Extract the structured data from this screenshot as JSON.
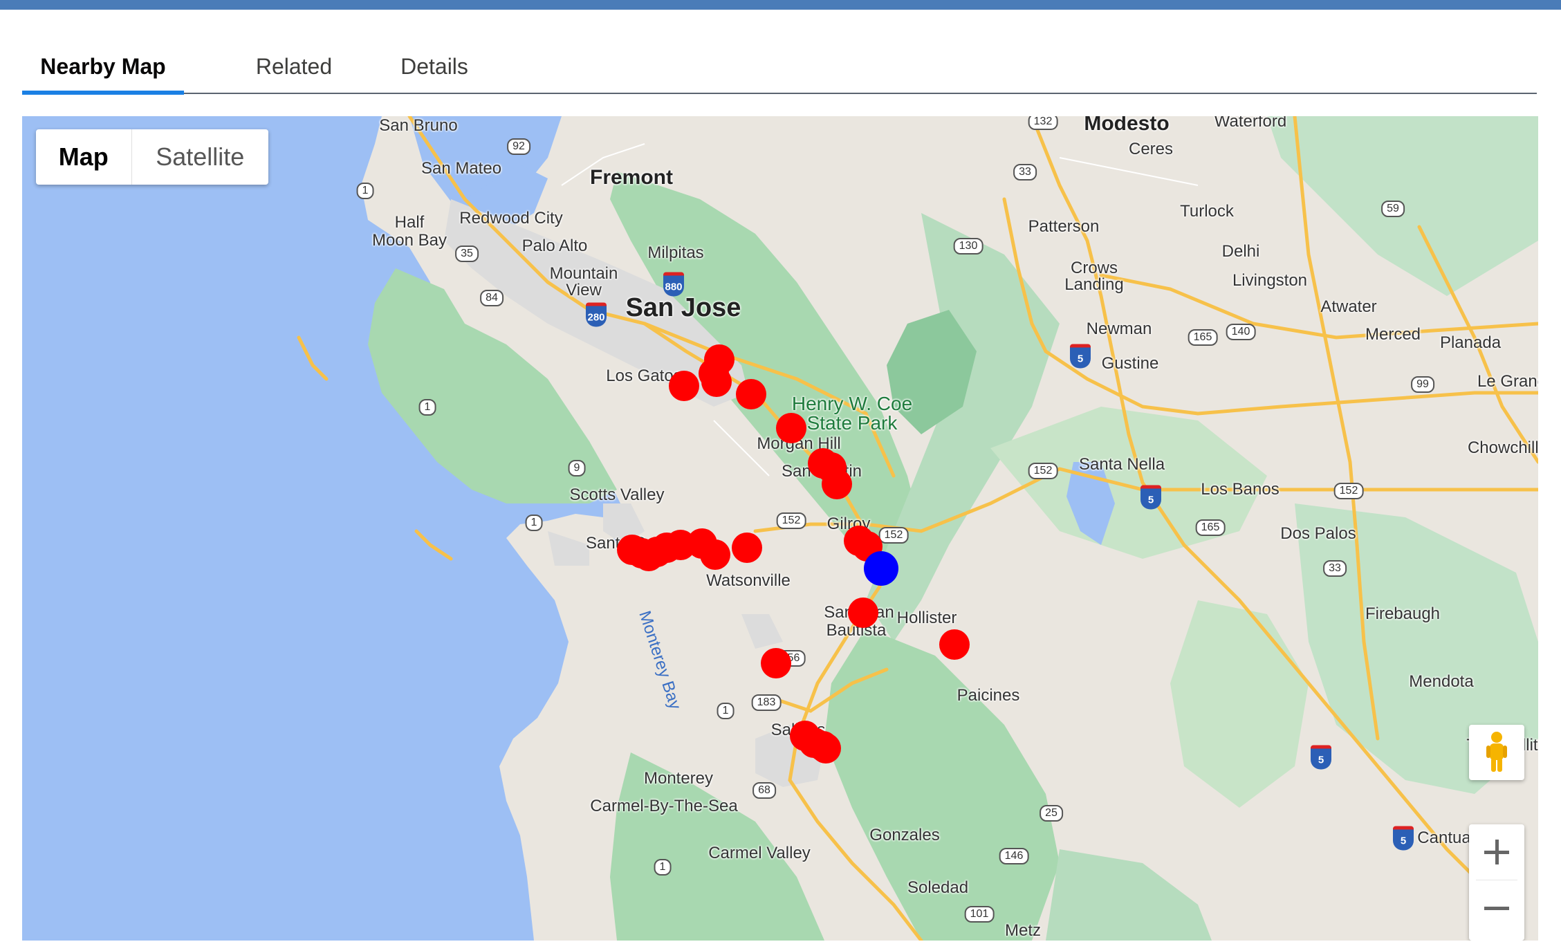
{
  "tabs": [
    {
      "label": "Nearby Map",
      "active": true
    },
    {
      "label": "Related",
      "active": false
    },
    {
      "label": "Details",
      "active": false
    }
  ],
  "map": {
    "map_type_buttons": [
      "Map",
      "Satellite"
    ],
    "selected_map_type": "Map",
    "zoom_in_icon": "plus-icon",
    "zoom_out_icon": "minus-icon",
    "street_view_icon": "pegman-icon",
    "current_location_color": "#0000ff",
    "nearby_marker_color": "#ff0000",
    "nearby_marker_count": 27,
    "current_location_count": 1,
    "labels": {
      "san_bruno": "San Bruno",
      "san_mateo": "San Mateo",
      "fremont": "Fremont",
      "half_moon_bay_1": "Half",
      "half_moon_bay_2": "Moon Bay",
      "redwood_city": "Redwood City",
      "palo_alto": "Palo Alto",
      "milpitas": "Milpitas",
      "mountain_view_1": "Mountain",
      "mountain_view_2": "View",
      "san_jose": "San Jose",
      "los_gatos": "Los Gatos",
      "henry_coe_1": "Henry W. Coe",
      "henry_coe_2": "State Park",
      "morgan_hill": "Morgan Hill",
      "san_martin": "San Martin",
      "scotts_valley": "Scotts Valley",
      "santa_cruz": "Santa Cruz",
      "gilroy": "Gilroy",
      "watsonville": "Watsonville",
      "monterey_bay": "Monterey Bay",
      "san_juan_1": "San Juan",
      "san_juan_2": "Bautista",
      "hollister": "Hollister",
      "paicines": "Paicines",
      "salinas": "Salinas",
      "monterey": "Monterey",
      "carmel": "Carmel-By-The-Sea",
      "carmel_valley": "Carmel Valley",
      "gonzales": "Gonzales",
      "soledad": "Soledad",
      "metz": "Metz",
      "modesto": "Modesto",
      "waterford": "Waterford",
      "ceres": "Ceres",
      "patterson": "Patterson",
      "turlock": "Turlock",
      "crows_landing_1": "Crows",
      "crows_landing_2": "Landing",
      "delhi": "Delhi",
      "livingston": "Livingston",
      "atwater": "Atwater",
      "newman": "Newman",
      "gustine": "Gustine",
      "merced": "Merced",
      "planada": "Planada",
      "le_grand": "Le Grand",
      "santa_nella": "Santa Nella",
      "los_banos": "Los Banos",
      "chowchilla": "Chowchilla",
      "dos_palos": "Dos Palos",
      "firebaugh": "Firebaugh",
      "mendota": "Mendota",
      "tranquility": "Tranquillit",
      "cantua": "Cantua"
    },
    "shields": {
      "s132": "132",
      "s92": "92",
      "s1a": "1",
      "s33a": "33",
      "s59": "59",
      "s130": "130",
      "s35": "35",
      "s84": "84",
      "s165a": "165",
      "s140": "140",
      "s99": "99",
      "s1b": "1",
      "s9": "9",
      "s152a": "152",
      "s152b": "152",
      "s1c": "1",
      "s152c": "152",
      "s152d": "152",
      "s165b": "165",
      "s33b": "33",
      "s156": "156",
      "s183": "183",
      "s1d": "1",
      "s68": "68",
      "s25": "25",
      "s146": "146",
      "s101": "101",
      "s1e": "1"
    },
    "interstates": {
      "i880": "880",
      "i280": "280",
      "i5a": "5",
      "i5b": "5",
      "i5c": "5",
      "i5d": "5"
    }
  }
}
